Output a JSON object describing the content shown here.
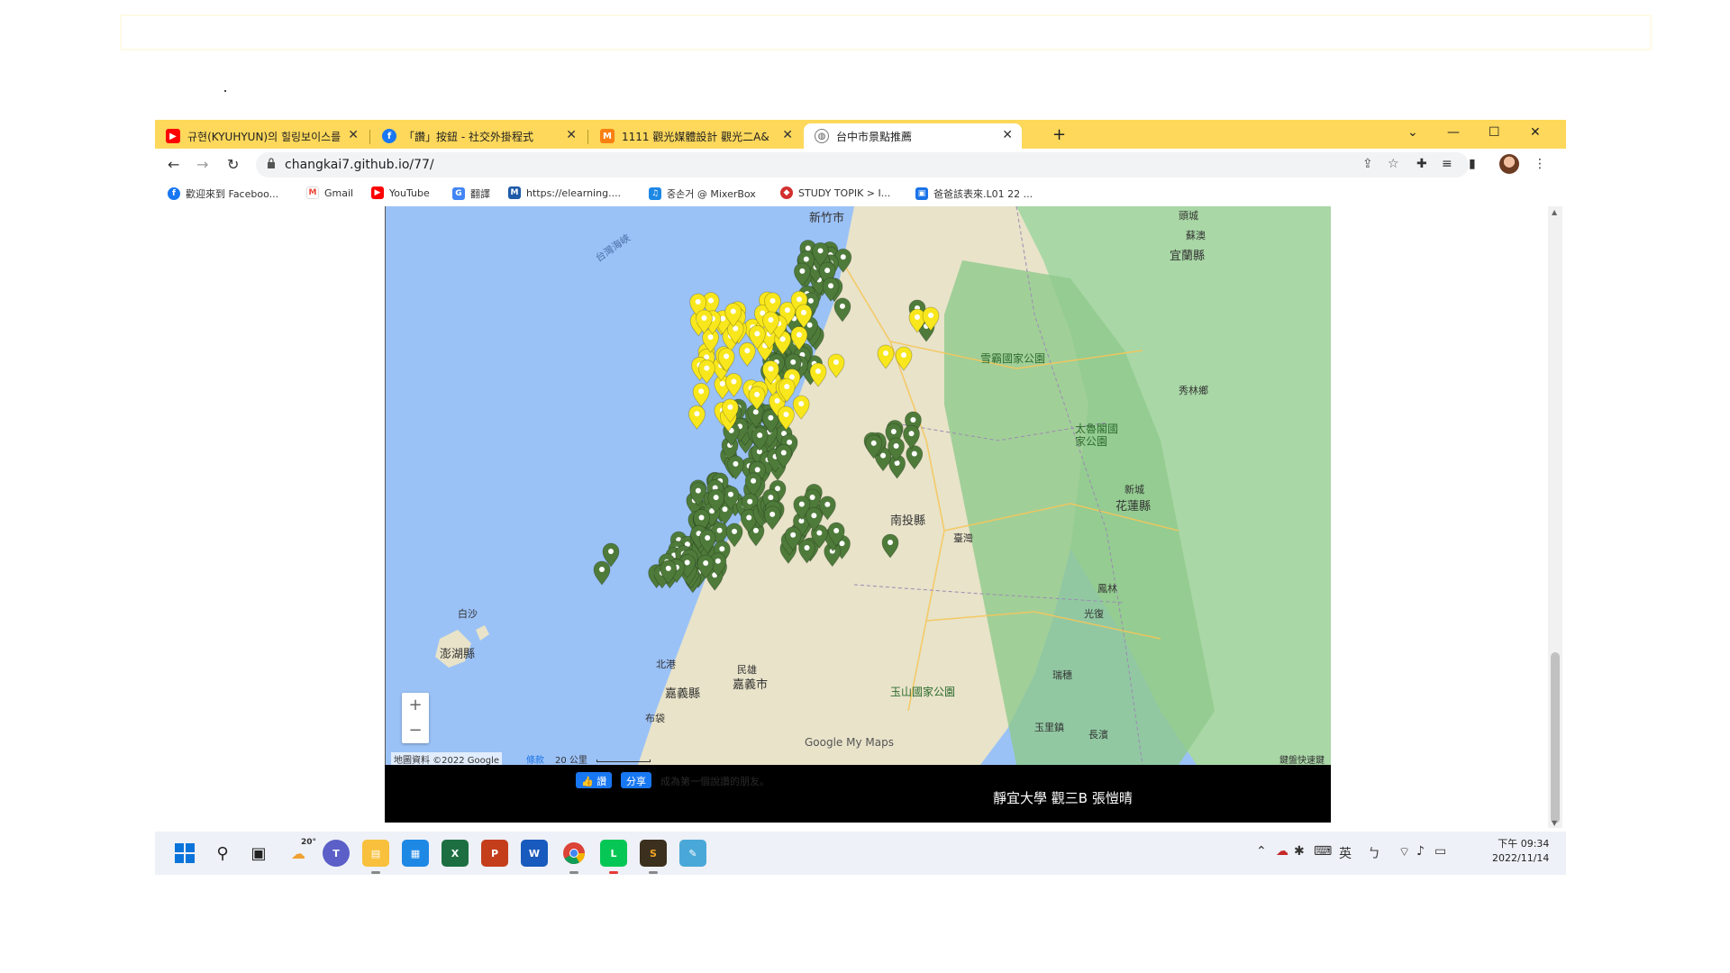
{
  "tabs": [
    {
      "label": "규현(KYUHYUN)의 힐링보이스를",
      "icon": "youtube-icon",
      "color": "#ff0000"
    },
    {
      "label": "「讚」按鈕 - 社交外掛程式",
      "icon": "facebook-icon",
      "color": "#1877f2"
    },
    {
      "label": "1111 觀光媒體設計 觀光二A&",
      "icon": "moodle-icon",
      "color": "#f98012"
    },
    {
      "label": "台中市景點推薦",
      "icon": "globe-icon",
      "color": "#555555"
    }
  ],
  "address": {
    "url": "changkai7.github.io/77/"
  },
  "bookmarks": [
    {
      "label": "歡迎來到 Faceboo...",
      "icon": "facebook-icon",
      "color": "#1877f2"
    },
    {
      "label": "Gmail",
      "icon": "gmail-icon",
      "color": "#ea4335"
    },
    {
      "label": "YouTube",
      "icon": "youtube-icon",
      "color": "#ff0000"
    },
    {
      "label": "翻譯",
      "icon": "translate-icon",
      "color": "#4285f4"
    },
    {
      "label": "https://elearning....",
      "icon": "moodle-icon",
      "color": "#1e5aa8"
    },
    {
      "label": "중손거 @ MixerBox",
      "icon": "mixerbox-icon",
      "color": "#1e88e5"
    },
    {
      "label": "STUDY TOPIK > I...",
      "icon": "topik-icon",
      "color": "#d32f2f"
    },
    {
      "label": "爸爸該表來.L01 22 ...",
      "icon": "classroom-icon",
      "color": "#1a73e8"
    }
  ],
  "map": {
    "labels": {
      "hsinchu": "新竹市",
      "yilan": "宜蘭縣",
      "taiwan_strait": "台灣海峽",
      "sheipa": "雪霸國家公園",
      "xiulin": "秀林鄉",
      "taroko": "太魯閣國家公園",
      "xincheng": "新城",
      "hualien": "花蓮縣",
      "nantou": "南投縣",
      "taiwan": "臺灣",
      "fenglin": "鳳林",
      "guangfu": "光復",
      "baisha": "白沙",
      "penghu": "澎湖縣",
      "chiayi": "嘉義縣",
      "yushan": "玉山國家公園",
      "ruisui": "瑞穗",
      "yuli": "玉里鎮",
      "changbin": "長濱",
      "minxiong": "民雄",
      "chiayi_city": "嘉義市",
      "beigang": "北港",
      "budai": "布袋",
      "suao": "蘇澳",
      "toucheng": "頭城"
    },
    "zoom_in": "+",
    "zoom_out": "−",
    "attribution": "地圖資料 ©2022 Google",
    "terms": "條款",
    "scale": "20 公里",
    "shortcuts": "鍵盤快速鍵",
    "google_logo": "Google My Maps"
  },
  "footer": {
    "like": "讚",
    "share": "分享",
    "prompt": "成為第一個說讚的朋友。",
    "credit": "靜宜大學 觀三B 張愷晴"
  },
  "taskbar": {
    "weather": "20°",
    "time": "下午 09:34",
    "date": "2022/11/14",
    "ime": "英"
  },
  "colors": {
    "tabstrip": "#fdd85b",
    "pin_green": "#4e7b3a",
    "pin_yellow": "#f8e71c"
  }
}
